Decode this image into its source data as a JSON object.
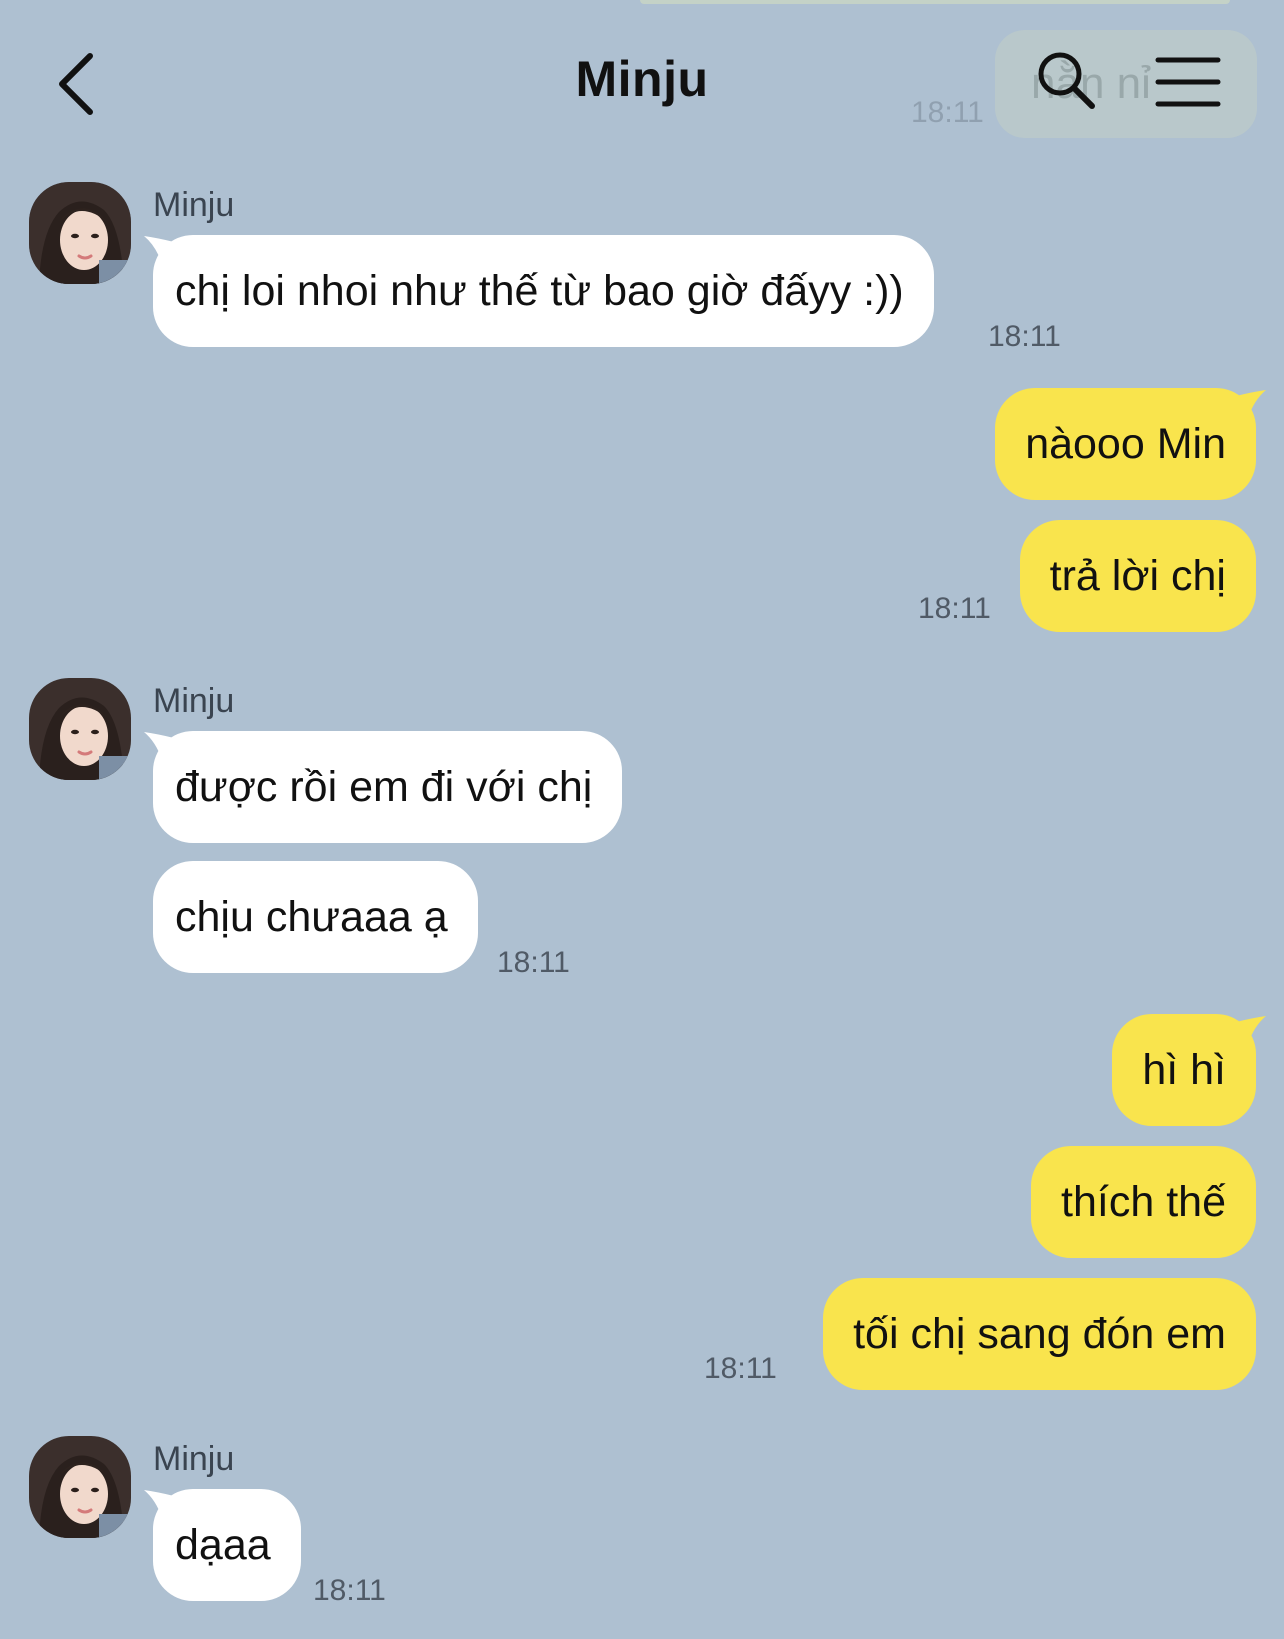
{
  "header": {
    "title": "Minju",
    "back_icon": "chevron-left-icon",
    "search_icon": "search-icon",
    "menu_icon": "menu-icon"
  },
  "ghost": {
    "text": "nằn nỉ",
    "time": "18:11"
  },
  "colors": {
    "background": "#aec0d1",
    "incoming_bubble": "#ffffff",
    "outgoing_bubble": "#f9e44d"
  },
  "messages": [
    {
      "sender": "Minju",
      "text": "chị loi nhoi như thế từ bao giờ đấyy :))",
      "time": "18:11"
    },
    {
      "text": "nàooo Min"
    },
    {
      "text": "trả lời chị",
      "time": "18:11"
    },
    {
      "sender": "Minju",
      "text": "được rồi em đi với chị"
    },
    {
      "text": "chịu chưaaa ạ",
      "time": "18:11"
    },
    {
      "text": "hì hì"
    },
    {
      "text": "thích thế"
    },
    {
      "text": "tối chị sang đón em",
      "time": "18:11"
    },
    {
      "sender": "Minju",
      "text": "dạaa",
      "time": "18:11"
    }
  ]
}
